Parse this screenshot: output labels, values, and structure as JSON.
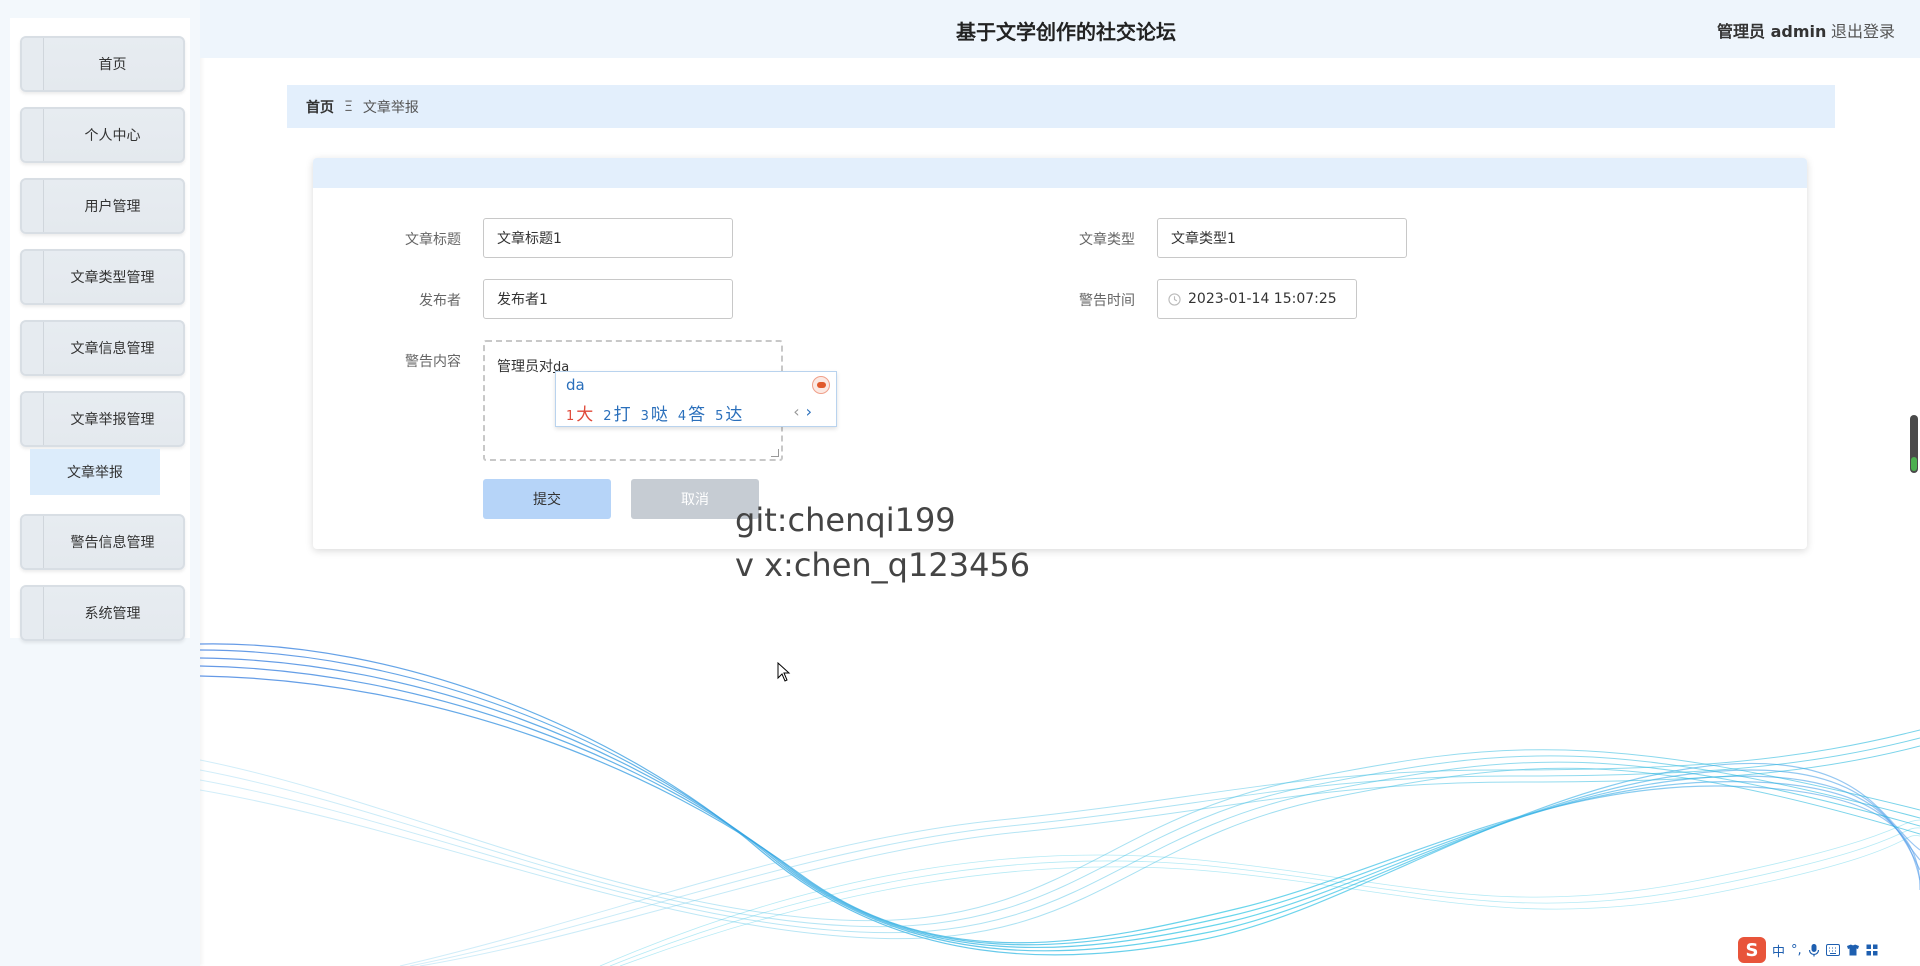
{
  "header": {
    "site_title": "基于文学创作的社交论坛",
    "admin_label": "管理员 admin",
    "logout_label": "退出登录"
  },
  "sidebar": {
    "items": [
      {
        "label": "首页"
      },
      {
        "label": "个人中心"
      },
      {
        "label": "用户管理"
      },
      {
        "label": "文章类型管理"
      },
      {
        "label": "文章信息管理"
      },
      {
        "label": "文章举报管理"
      },
      {
        "label": "警告信息管理"
      },
      {
        "label": "系统管理"
      }
    ],
    "submenu_active": "文章举报"
  },
  "breadcrumb": {
    "home": "首页",
    "separator": "Ξ",
    "current": "文章举报"
  },
  "form": {
    "title_label": "文章标题",
    "title_value": "文章标题1",
    "type_label": "文章类型",
    "type_value": "文章类型1",
    "publisher_label": "发布者",
    "publisher_value": "发布者1",
    "warn_time_label": "警告时间",
    "warn_time_value": "2023-01-14 15:07:25",
    "warn_content_label": "警告内容",
    "warn_content_value": "管理员对",
    "warn_content_composing": "da",
    "submit_label": "提交",
    "cancel_label": "取消"
  },
  "ime": {
    "pinyin": "da",
    "candidates": [
      {
        "num": "1",
        "char": "大"
      },
      {
        "num": "2",
        "char": "打"
      },
      {
        "num": "3",
        "char": "哒"
      },
      {
        "num": "4",
        "char": "答"
      },
      {
        "num": "5",
        "char": "达"
      }
    ],
    "prev": "‹",
    "next": "›"
  },
  "watermark": {
    "line1": "git:chenqi199",
    "line2": "v x:chen_q123456"
  },
  "ime_toolbar": {
    "logo": "S",
    "mode": "中",
    "punct": "°,"
  },
  "colors": {
    "accent_light": "#e3effc",
    "submit_bg": "#b6d4f8",
    "cancel_bg": "#c6ccd3",
    "wave_blue": "#4a90e2",
    "wave_cyan": "#25c6e0"
  }
}
